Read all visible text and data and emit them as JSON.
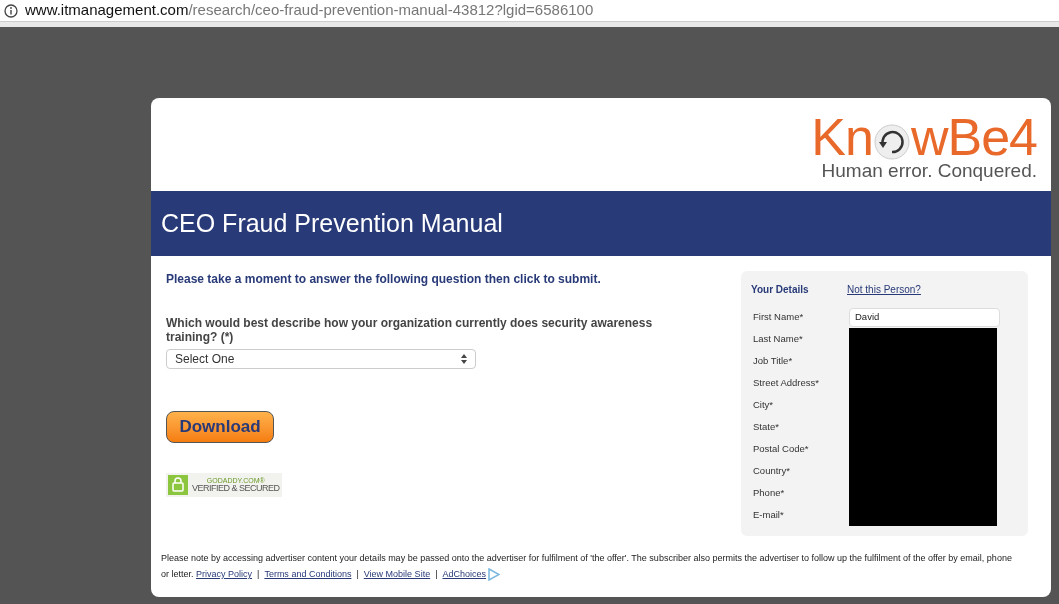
{
  "address_bar": {
    "domain": "www.itmanagement.com",
    "path": "/research/ceo-fraud-prevention-manual-43812?lgid=6586100"
  },
  "logo": {
    "text_before": "Kn",
    "text_after": "wBe4",
    "tagline": "Human error. Conquered."
  },
  "banner": {
    "title": "CEO Fraud Prevention Manual"
  },
  "intro": "Please take a moment to answer the following question then click to submit.",
  "question": {
    "label": "Which would best describe how your organization currently does security awareness training? (*)",
    "select_value": "Select One"
  },
  "download_button": "Download",
  "seal": {
    "top": "GODADDY.COM®",
    "bottom": "VERIFIED & SECURED"
  },
  "details": {
    "title": "Your Details",
    "link": "Not this Person?",
    "fields": [
      {
        "label": "First Name*",
        "value": "David",
        "redacted": false
      },
      {
        "label": "Last Name*",
        "redacted": true
      },
      {
        "label": "Job Title*",
        "redacted": true
      },
      {
        "label": "Street Address*",
        "redacted": true
      },
      {
        "label": "City*",
        "redacted": true
      },
      {
        "label": "State*",
        "redacted": true
      },
      {
        "label": "Postal Code*",
        "redacted": true
      },
      {
        "label": "Country*",
        "redacted": true
      },
      {
        "label": "Phone*",
        "redacted": true
      },
      {
        "label": "E-mail*",
        "redacted": true
      }
    ]
  },
  "footer": {
    "note": "Please note by accessing advertiser content your details may be passed onto the advertiser for fulfilment of 'the offer'. The subscriber also permits the advertiser to follow up the fulfilment of the offer by email, phone or letter.",
    "links": [
      "Privacy Policy",
      "Terms and Conditions",
      "View Mobile Site",
      "AdChoices"
    ],
    "separator": "|"
  }
}
